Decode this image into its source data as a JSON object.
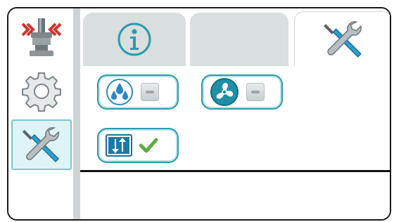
{
  "sidebar": {
    "items": [
      {
        "name": "compression-icon",
        "active": false
      },
      {
        "name": "gear-icon",
        "active": false
      },
      {
        "name": "tools-icon",
        "active": true
      }
    ]
  },
  "tabs": [
    {
      "name": "info-icon",
      "active": false
    },
    {
      "name": "",
      "active": false
    },
    {
      "name": "tools-icon",
      "active": true
    }
  ],
  "controls": [
    {
      "name": "water-drops-icon",
      "state": "off"
    },
    {
      "name": "fan-icon",
      "state": "off"
    },
    {
      "name": "up-down-arrows-icon",
      "state": "on"
    }
  ],
  "colors": {
    "accent": "#2a9aac",
    "accent_light": "#dff4f6",
    "check_green": "#5cab3e",
    "tab_inactive": "#d9dedf",
    "sidebar_rail": "#cfd4d6"
  }
}
